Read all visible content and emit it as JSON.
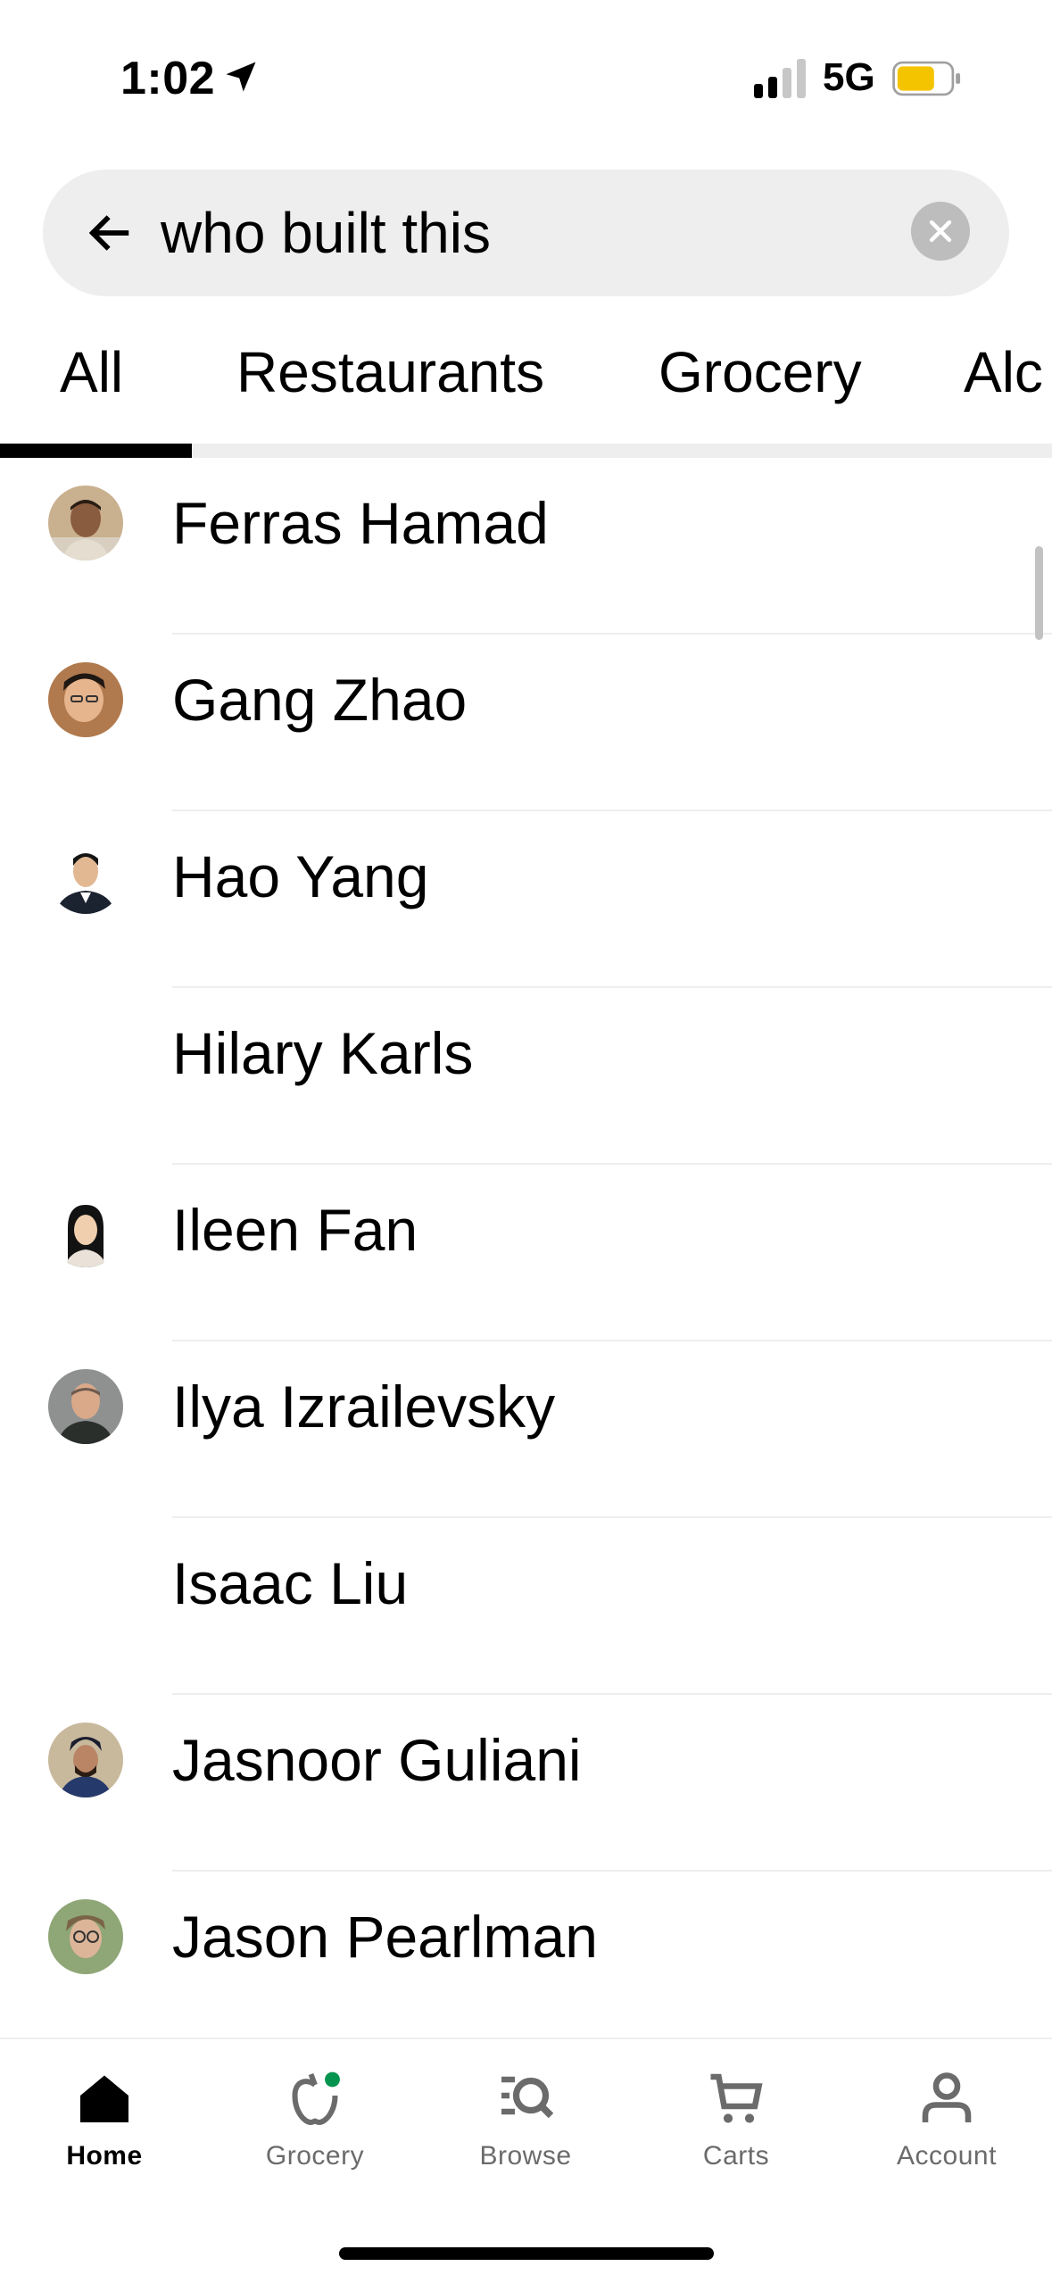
{
  "status_bar": {
    "time": "1:02",
    "network": "5G",
    "battery_color": "#F5C400"
  },
  "search": {
    "query": "who built this",
    "back_icon": "arrow-left-icon",
    "clear_icon": "close-icon"
  },
  "tabs": [
    {
      "label": "All",
      "active": true
    },
    {
      "label": "Restaurants",
      "active": false
    },
    {
      "label": "Grocery",
      "active": false
    },
    {
      "label": "Alc",
      "active": false
    }
  ],
  "results": [
    {
      "name": "Ferras Hamad",
      "avatar": "photo"
    },
    {
      "name": "Gang Zhao",
      "avatar": "photo"
    },
    {
      "name": "Hao Yang",
      "avatar": "photo"
    },
    {
      "name": "Hilary Karls",
      "avatar": "none"
    },
    {
      "name": "Ileen Fan",
      "avatar": "photo"
    },
    {
      "name": "Ilya Izrailevsky",
      "avatar": "photo"
    },
    {
      "name": "Isaac Liu",
      "avatar": "none"
    },
    {
      "name": "Jasnoor Guliani",
      "avatar": "photo"
    },
    {
      "name": "Jason Pearlman",
      "avatar": "photo"
    }
  ],
  "bottom_nav": [
    {
      "label": "Home",
      "icon": "home-icon",
      "active": true
    },
    {
      "label": "Grocery",
      "icon": "grocery-icon",
      "active": false
    },
    {
      "label": "Browse",
      "icon": "browse-icon",
      "active": false
    },
    {
      "label": "Carts",
      "icon": "cart-icon",
      "active": false
    },
    {
      "label": "Account",
      "icon": "account-icon",
      "active": false
    }
  ],
  "colors": {
    "accent_dot": "#05944F",
    "inactive_label": "#6b6b6b"
  }
}
